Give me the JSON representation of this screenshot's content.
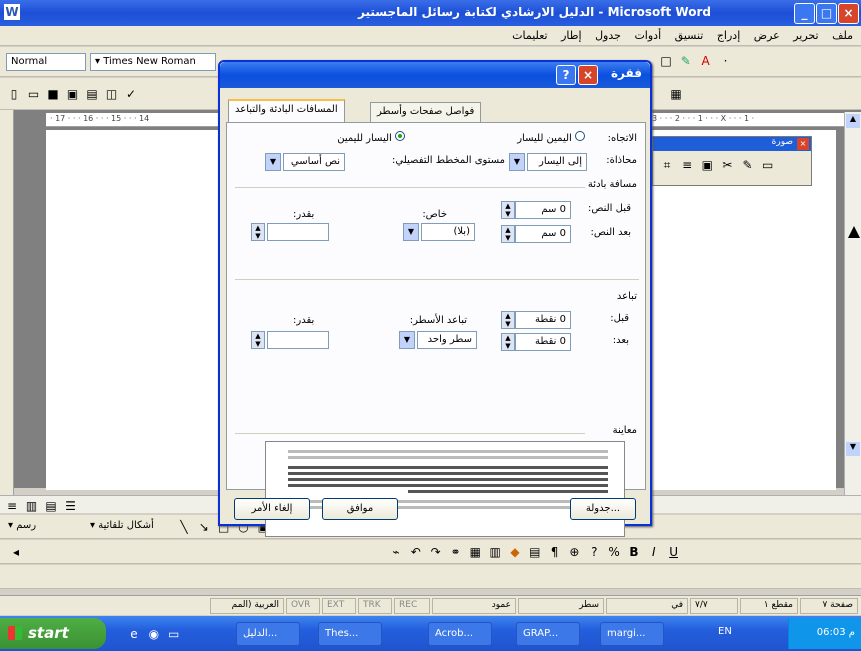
{
  "window": {
    "title": "Microsoft Word - الدليل الارشادي لكتابة رسائل الماجستير",
    "buttons": {
      "minimize": "_",
      "maximize": "□",
      "close": "×"
    }
  },
  "menu": [
    "ملف",
    "تحرير",
    "عرض",
    "إدراج",
    "تنسيق",
    "أدوات",
    "جدول",
    "إطار",
    "تعليمات"
  ],
  "toolbar": {
    "style_value": "Normal",
    "font_value": "Times New Roman"
  },
  "ruler": {
    "marks": "· 17 · · · 16 · · · 15 · · · 14",
    "right_marks": "3 · · · 2 · · · 1 · · · X · · · 1 ·"
  },
  "floating_toolbar": {
    "title": "صورة"
  },
  "dialog": {
    "title": "فقرة",
    "help_label": "?",
    "close_label": "×",
    "tabs": [
      "المسافات البادئة والتباعد",
      "فواصل صفحات وأسطر"
    ],
    "direction": {
      "label": "الاتجاه:",
      "options": [
        "اليمين لليسار",
        "اليسار لليمين"
      ]
    },
    "alignment": {
      "label": "محاذاة:",
      "value": "إلى اليسار"
    },
    "outline": {
      "label": "مستوى المخطط التفصيلي:",
      "value": "نص أساسي"
    },
    "indentation": {
      "section": "مسافة بادئة",
      "before_label": "قبل النص:",
      "before_value": "0 سم",
      "after_label": "بعد النص:",
      "after_value": "0 سم",
      "special_label": "خاص:",
      "special_value": "(بلا)",
      "by_label": "بقدر:",
      "by_value": ""
    },
    "spacing": {
      "section": "تباعد",
      "before_label": "قبل:",
      "before_value": "0 نقطة",
      "after_label": "بعد:",
      "after_value": "0 نقطة",
      "line_label": "تباعد الأسطر:",
      "line_value": "سطر واحد",
      "at_label": "بقدر:",
      "at_value": ""
    },
    "preview_label": "معاينة",
    "buttons": {
      "tabs": "جدولة...",
      "ok": "موافق",
      "cancel": "إلغاء الأمر"
    }
  },
  "drawing_toolbar": {
    "shapes_label": "أشكال تلقائية",
    "draw_label": "رسم"
  },
  "status": {
    "page": "صفحة",
    "page_num": "٧",
    "section": "مقطع",
    "section_num": "١",
    "pages": "٧/٧",
    "at": "في",
    "line": "سطر",
    "col": "عمود",
    "rec": "REC",
    "trk": "TRK",
    "ext": "EXT",
    "ovr": "OVR",
    "language": "العربية (المم"
  },
  "taskbar": {
    "start_label": "start",
    "items": [
      "الدليل...",
      "Thes...",
      "Acrob...",
      "GRAP...",
      "margi..."
    ],
    "lang": "EN",
    "clock": "06:03 م"
  }
}
